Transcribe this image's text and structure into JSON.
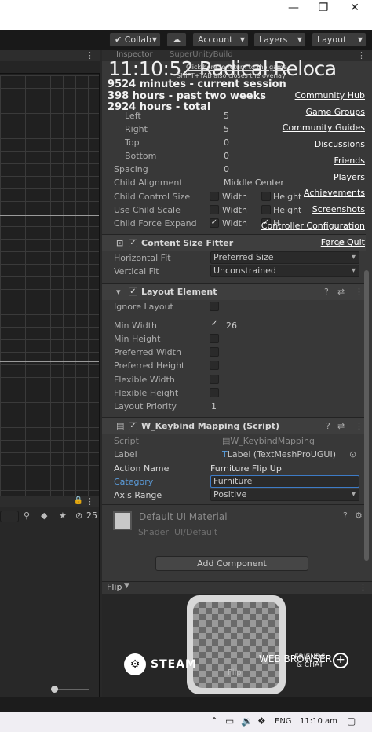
{
  "window": {
    "minimize": "—",
    "restore": "❐",
    "close": "✕"
  },
  "toolbar": {
    "collab": "Collab",
    "cloud_icon": "cloud-icon",
    "account": "Account",
    "layers": "Layers",
    "layout": "Layout"
  },
  "inspector": {
    "tab": "Inspector",
    "object": "SuperUnityBuild",
    "padding": [
      {
        "label": "Left",
        "value": "5"
      },
      {
        "label": "Right",
        "value": "5"
      },
      {
        "label": "Top",
        "value": "0"
      },
      {
        "label": "Bottom",
        "value": "0"
      }
    ],
    "spacing": {
      "label": "Spacing",
      "value": "0"
    },
    "child_alignment": {
      "label": "Child Alignment",
      "value": "Middle Center"
    },
    "child_control_size": {
      "label": "Child Control Size",
      "width": "Width",
      "height": "Height"
    },
    "use_child_scale": {
      "label": "Use Child Scale",
      "width": "Width",
      "height": "Height"
    },
    "child_force_expand": {
      "label": "Child Force Expand",
      "width": "Width",
      "height": "H"
    },
    "content_size_fitter": {
      "title": "Content Size Fitter",
      "horizontal": {
        "label": "Horizontal Fit",
        "value": "Preferred Size"
      },
      "vertical": {
        "label": "Vertical Fit",
        "value": "Unconstrained"
      }
    },
    "layout_element": {
      "title": "Layout Element",
      "ignore_layout": "Ignore Layout",
      "min_width": {
        "label": "Min Width",
        "value": "26"
      },
      "min_height": "Min Height",
      "preferred_width": "Preferred Width",
      "preferred_height": "Preferred Height",
      "flexible_width": "Flexible Width",
      "flexible_height": "Flexible Height",
      "layout_priority": {
        "label": "Layout Priority",
        "value": "1"
      }
    },
    "keybind": {
      "title": "W_Keybind Mapping (Script)",
      "script": {
        "label": "Script",
        "value": "W_KeybindMapping"
      },
      "label": {
        "label": "Label",
        "value": "Label (TextMeshProUGUI)"
      },
      "action_name": {
        "label": "Action Name",
        "value": "Furniture Flip Up"
      },
      "category": {
        "label": "Category",
        "value": "Furniture"
      },
      "axis_range": {
        "label": "Axis Range",
        "value": "Positive"
      }
    },
    "material": {
      "name": "Default UI Material",
      "shader_label": "Shader",
      "shader_value": "UI/Default"
    },
    "add_component": "Add Component",
    "preview_label": "Flip",
    "preview_caption": "Flip"
  },
  "overlay": {
    "time": "11:10:52",
    "title": "Radical Reloca",
    "hint_line1": "Click here to return to the game",
    "hint_line2": "SHIFT+TAB also closes the overlay",
    "stats": [
      "9524 minutes - current session",
      "398 hours - past two weeks",
      "2924 hours - total"
    ],
    "links": [
      "Community Hub",
      "Game Groups",
      "Community Guides",
      "Discussions",
      "Friends",
      "Players",
      "Achievements",
      "Screenshots",
      "Controller Configuration",
      "Force Quit"
    ],
    "steam": "STEAM",
    "web_browser": "WEB BROWSER",
    "friends_chat": "FRIENDS & CHAT"
  },
  "project": {
    "count": "25"
  },
  "taskbar": {
    "language": "ENG",
    "time": "11:10 am"
  }
}
